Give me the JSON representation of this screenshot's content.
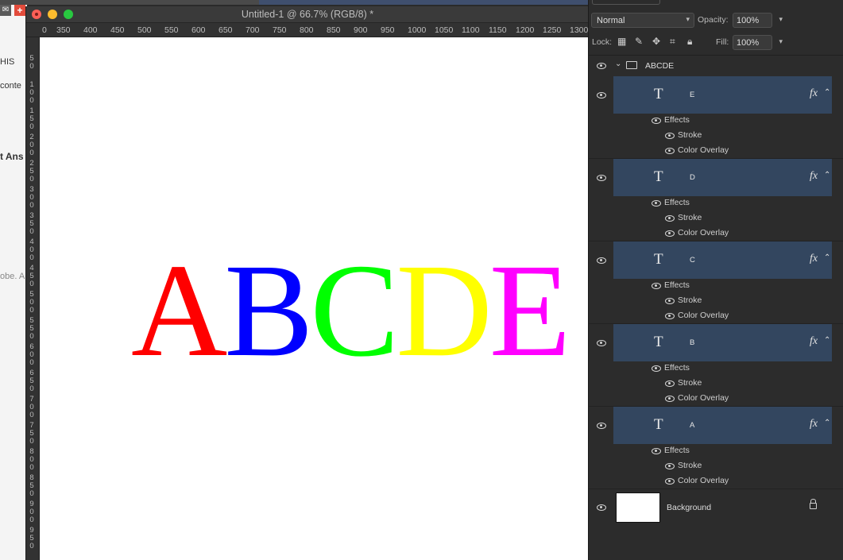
{
  "background_page": {
    "snippets": [
      "HIS",
      "conte",
      "t Ans",
      "obe. A"
    ]
  },
  "document": {
    "title": "Untitled-1 @ 66.7% (RGB/8) *",
    "ruler_h": [
      "0",
      "350",
      "400",
      "450",
      "500",
      "550",
      "600",
      "650",
      "700",
      "750",
      "800",
      "850",
      "900",
      "950",
      "1000",
      "1050",
      "1100",
      "1150",
      "1200",
      "1250",
      "1300"
    ],
    "ruler_v": [
      "50",
      "100",
      "150",
      "200",
      "250",
      "300",
      "350",
      "400",
      "450",
      "500",
      "550",
      "600",
      "650",
      "700",
      "750",
      "800",
      "850",
      "900",
      "950"
    ],
    "letters": [
      {
        "char": "A",
        "color": "#ff0000"
      },
      {
        "char": "B",
        "color": "#0000ff"
      },
      {
        "char": "C",
        "color": "#00ff00"
      },
      {
        "char": "D",
        "color": "#ffff00"
      },
      {
        "char": "E",
        "color": "#ff00ff"
      }
    ]
  },
  "layers_panel": {
    "blend_mode": "Normal",
    "opacity_label": "Opacity:",
    "opacity_value": "100%",
    "lock_label": "Lock:",
    "fill_label": "Fill:",
    "fill_value": "100%",
    "group_name": "ABCDE",
    "fx_label": "fx",
    "effects_label": "Effects",
    "stroke_label": "Stroke",
    "overlay_label": "Color Overlay",
    "type_glyph": "T",
    "layers": [
      "E",
      "D",
      "C",
      "B",
      "A"
    ],
    "background_layer": "Background",
    "selected_color": "#33465f"
  }
}
